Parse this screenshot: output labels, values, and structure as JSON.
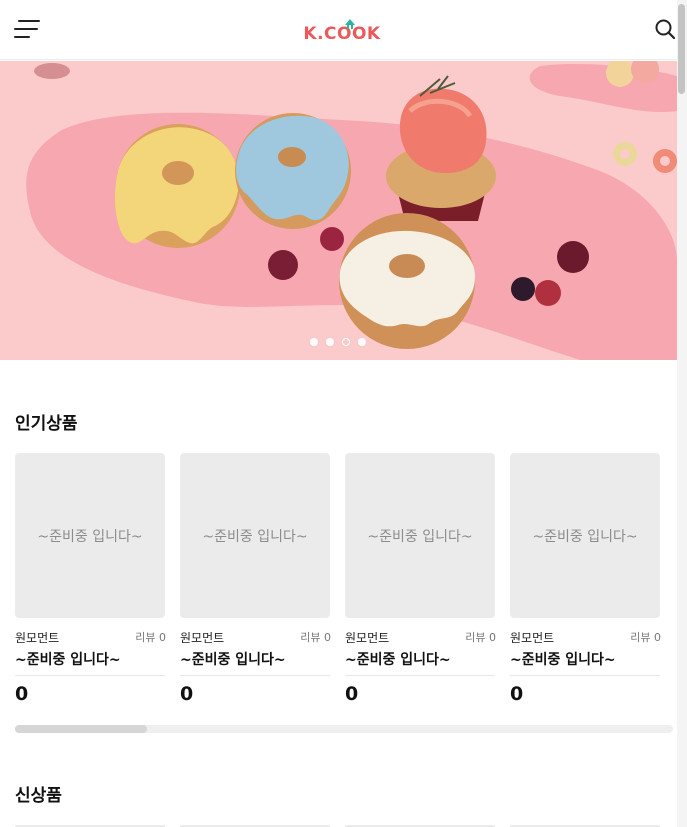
{
  "header": {
    "logo_text": "K.COOK",
    "menu_icon": "hamburger-menu-icon",
    "search_icon": "search-icon",
    "brand_color": "#ea5a5a",
    "accent_color": "#2bb3a3"
  },
  "banner": {
    "image": "donuts-and-cupcake-photo",
    "slide_count": 4,
    "active_slide": 3,
    "background_color": "#f9c9c9"
  },
  "popular": {
    "title": "인기상품",
    "products": [
      {
        "placeholder": "~준비중 입니다~",
        "brand": "원모먼트",
        "review": "리뷰 0",
        "name": "~준비중 입니다~",
        "price": "0"
      },
      {
        "placeholder": "~준비중 입니다~",
        "brand": "원모먼트",
        "review": "리뷰 0",
        "name": "~준비중 입니다~",
        "price": "0"
      },
      {
        "placeholder": "~준비중 입니다~",
        "brand": "원모먼트",
        "review": "리뷰 0",
        "name": "~준비중 입니다~",
        "price": "0"
      },
      {
        "placeholder": "~준비중 입니다~",
        "brand": "원모먼트",
        "review": "리뷰 0",
        "name": "~준비중 입니다~",
        "price": "0"
      }
    ],
    "scroll_progress": 0.2
  },
  "new_products": {
    "title": "신상품"
  }
}
